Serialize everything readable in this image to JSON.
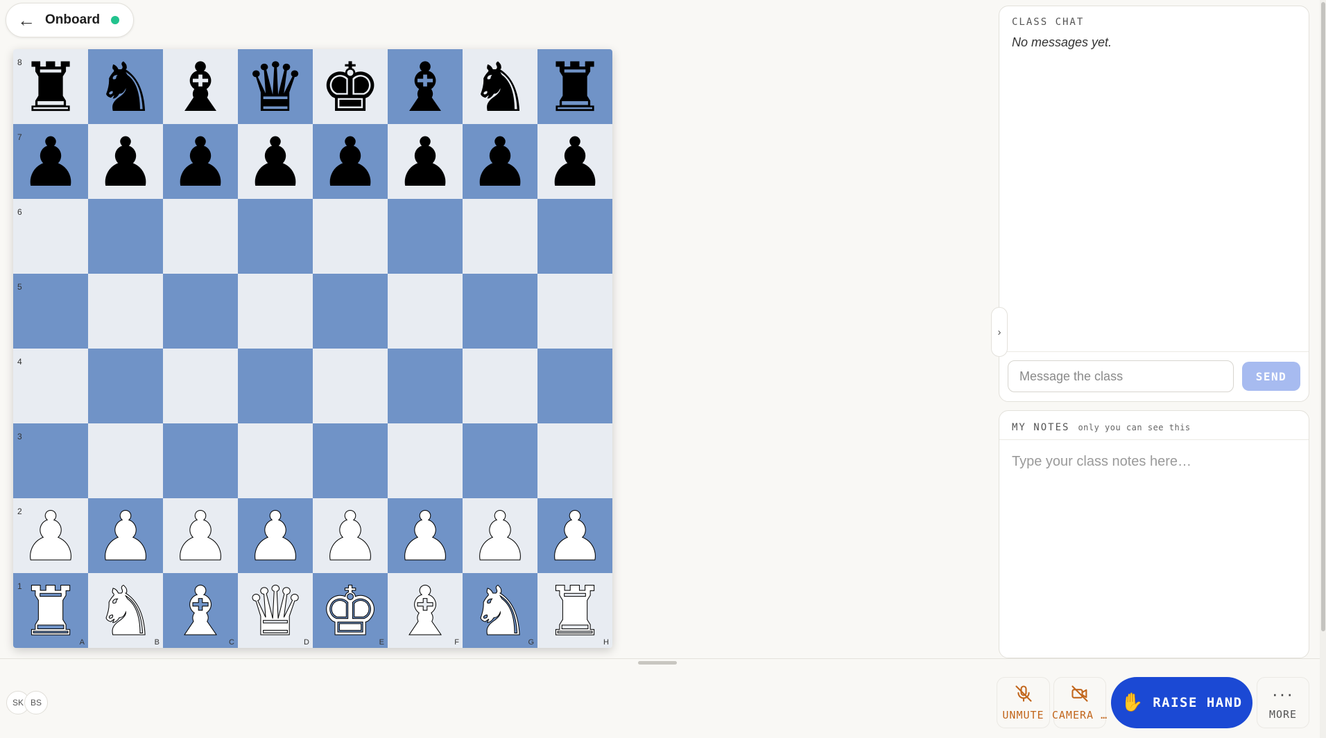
{
  "header": {
    "back_icon": "←",
    "title": "Onboard",
    "status": "live"
  },
  "board": {
    "ranks": [
      "8",
      "7",
      "6",
      "5",
      "4",
      "3",
      "2",
      "1"
    ],
    "files": [
      "A",
      "B",
      "C",
      "D",
      "E",
      "F",
      "G",
      "H"
    ],
    "position": [
      [
        "r",
        "n",
        "b",
        "q",
        "k",
        "b",
        "n",
        "r"
      ],
      [
        "p",
        "p",
        "p",
        "p",
        "p",
        "p",
        "p",
        "p"
      ],
      [
        "",
        "",
        "",
        "",
        "",
        "",
        "",
        ""
      ],
      [
        "",
        "",
        "",
        "",
        "",
        "",
        "",
        ""
      ],
      [
        "",
        "",
        "",
        "",
        "",
        "",
        "",
        ""
      ],
      [
        "",
        "",
        "",
        "",
        "",
        "",
        "",
        ""
      ],
      [
        "P",
        "P",
        "P",
        "P",
        "P",
        "P",
        "P",
        "P"
      ],
      [
        "R",
        "N",
        "B",
        "Q",
        "K",
        "B",
        "N",
        "R"
      ]
    ],
    "colors": {
      "light": "#e8ecf2",
      "dark": "#7093c7"
    }
  },
  "participants": [
    "SK",
    "BS"
  ],
  "controls": {
    "unmute": {
      "label": "UNMUTE",
      "icon": "mic-off-icon"
    },
    "camera": {
      "label": "CAMERA …",
      "icon": "camera-off-icon"
    },
    "raise_hand": {
      "label": "RAISE HAND",
      "icon": "✋"
    },
    "more": {
      "label": "MORE",
      "icon": "···"
    }
  },
  "chat": {
    "title": "CLASS CHAT",
    "empty_text": "No messages yet.",
    "input_placeholder": "Message the class",
    "send_label": "SEND",
    "collapse_icon": "›"
  },
  "notes": {
    "title": "MY NOTES",
    "subtitle": "only you can see this",
    "placeholder": "Type your class notes here…"
  },
  "accent": {
    "primary": "#1b49d4",
    "media_off": "#c2661c",
    "live": "#22c38e"
  }
}
